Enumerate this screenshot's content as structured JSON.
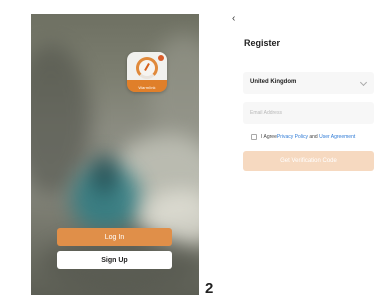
{
  "welcome": {
    "logo": {
      "icon": "thermostat-dial-icon",
      "brand": "Warmlink"
    },
    "login_label": "Log In",
    "signup_label": "Sign Up",
    "colors": {
      "login": "#e08f49",
      "signup": "#ffffff"
    }
  },
  "page_mark": "2",
  "register": {
    "back_icon": "‹",
    "title": "Register",
    "country": {
      "selected": "United Kingdom",
      "icon": "chevron-down-icon"
    },
    "email": {
      "value": "",
      "placeholder": "Email Address"
    },
    "agreement": {
      "checked": false,
      "prefix": "I Agree",
      "privacy_link": "Privacy Policy",
      "and_text": " and ",
      "user_link": "User Agreement"
    },
    "verify_label": "Get Verification Code",
    "colors": {
      "verify": "#f6d9c0",
      "link": "#2f7bd6"
    }
  }
}
